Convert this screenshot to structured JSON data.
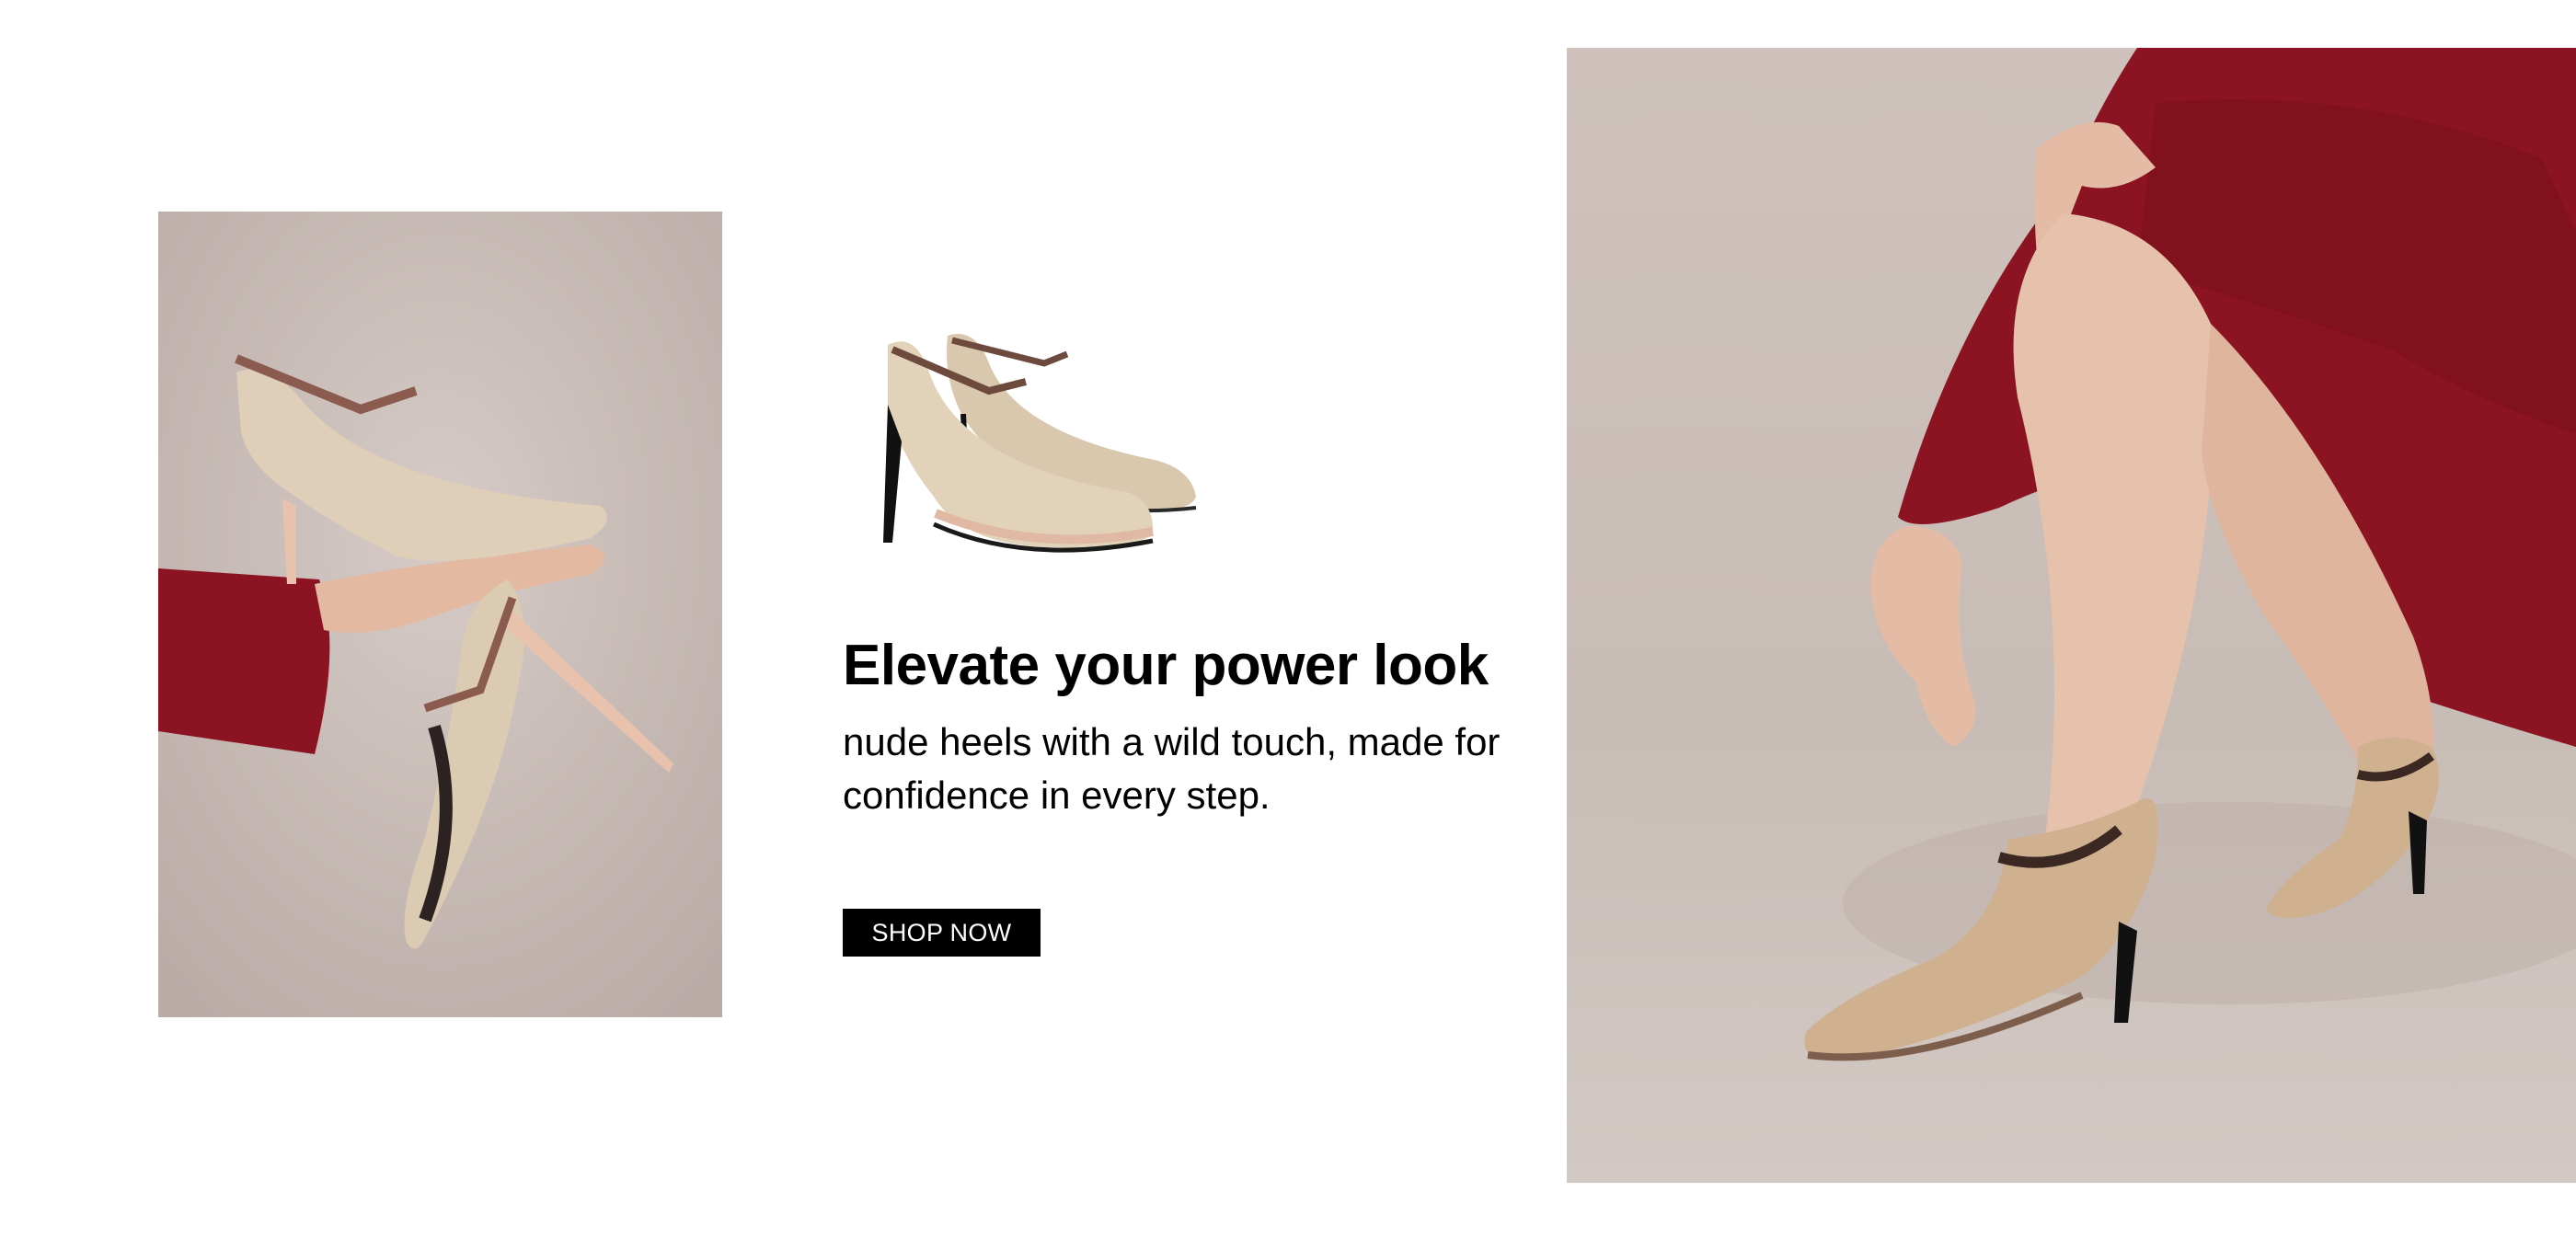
{
  "hero": {
    "headline": "Elevate your power look",
    "subtext": "nude heels with a wild touch, made for confidence in every step.",
    "cta_label": "SHOP NOW"
  },
  "colors": {
    "background": "#ffffff",
    "text": "#000000",
    "button_bg": "#000000",
    "button_text": "#ffffff",
    "dress_red": "#8c1422",
    "shoe_nude": "#d8c3a8",
    "backdrop_taupe": "#c9bcb6"
  }
}
